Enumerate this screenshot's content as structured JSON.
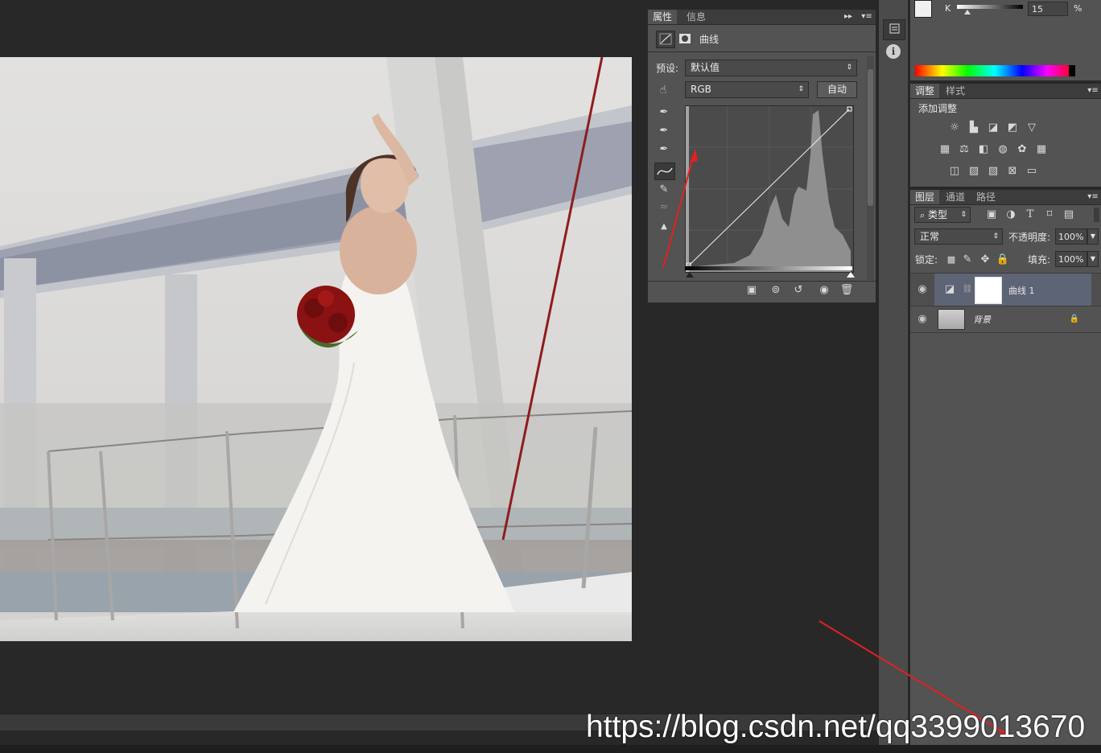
{
  "properties": {
    "tabs": [
      "属性",
      "信息"
    ],
    "title": "曲线",
    "preset_label": "预设:",
    "preset_value": "默认值",
    "channel_value": "RGB",
    "auto_button": "自动"
  },
  "color": {
    "k_label": "K",
    "k_value": "15",
    "k_unit": "%"
  },
  "adjustments": {
    "tabs": [
      "调整",
      "样式"
    ],
    "title": "添加调整"
  },
  "layers": {
    "tabs": [
      "图层",
      "通道",
      "路径"
    ],
    "filter_label": "类型",
    "blend_mode": "正常",
    "opacity_label": "不透明度:",
    "opacity_value": "100%",
    "lock_label": "锁定:",
    "fill_label": "填充:",
    "fill_value": "100%",
    "items": [
      {
        "name": "曲线 1"
      },
      {
        "name": "背景"
      }
    ]
  },
  "watermark": {
    "url": "https://blog.csdn.net/qq3399013670"
  }
}
